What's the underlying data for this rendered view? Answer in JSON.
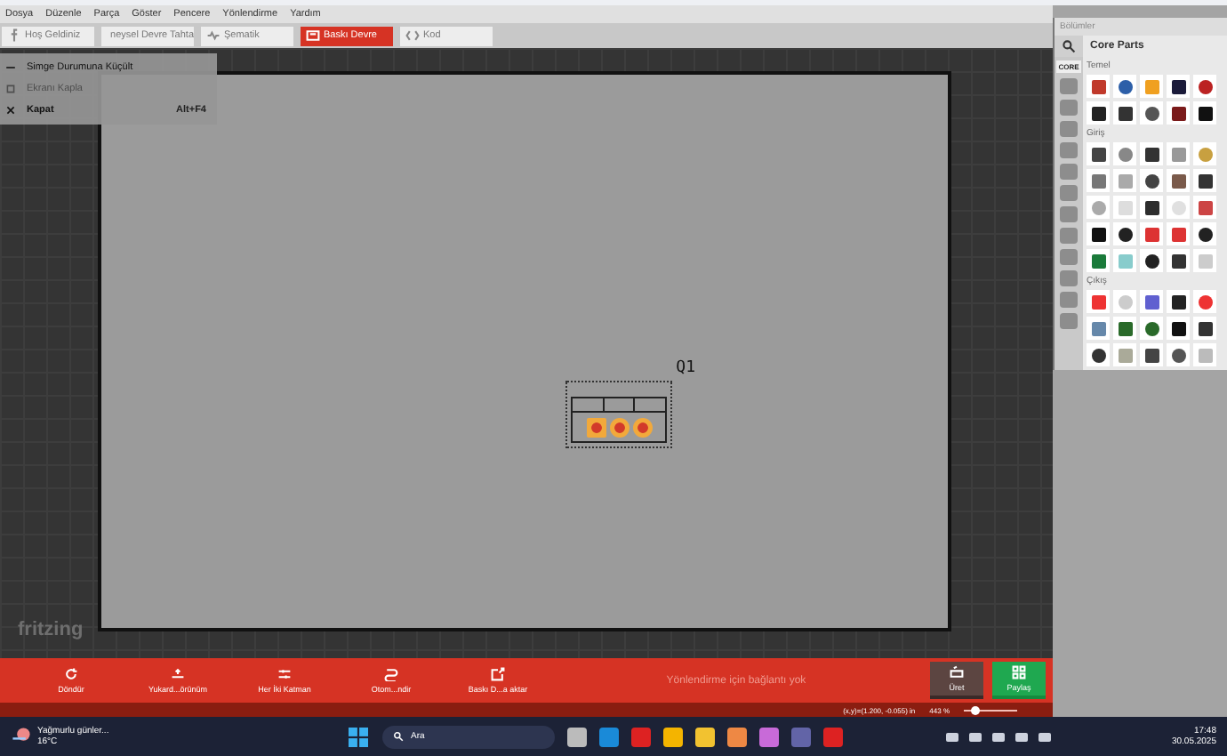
{
  "menu_bar": {
    "items": [
      {
        "label": "Dosya"
      },
      {
        "label": "Düzenle"
      },
      {
        "label": "Parça"
      },
      {
        "label": "Göster"
      },
      {
        "label": "Pencere"
      },
      {
        "label": "Yönlendirme"
      },
      {
        "label": "Yardım"
      }
    ]
  },
  "tabs": [
    {
      "label": "Hoş Geldiniz",
      "kind": "welcome",
      "selected": false
    },
    {
      "label": "neysel Devre Tahta",
      "kind": "breadboard",
      "selected": false
    },
    {
      "label": "Şematik",
      "kind": "schematic",
      "selected": false
    },
    {
      "label": "Baskı Devre",
      "kind": "pcb",
      "selected": true
    },
    {
      "label": "Kod",
      "kind": "code",
      "selected": false
    }
  ],
  "window_menu": {
    "items": [
      {
        "label": "Simge Durumuna Küçült",
        "kind": "minimize",
        "disabled": false
      },
      {
        "label": "Ekranı Kapla",
        "kind": "maximize",
        "disabled": true
      },
      {
        "label": "Kapat",
        "kind": "close",
        "shortcut": "Alt+F4",
        "disabled": false
      }
    ]
  },
  "canvas": {
    "watermark": "fritzing",
    "part": {
      "label": "Q1"
    }
  },
  "toolbar": {
    "buttons": [
      {
        "label": "Döndür",
        "kind": "rotate"
      },
      {
        "label": "Yukard...örünüm",
        "kind": "view"
      },
      {
        "label": "Her İki Katman",
        "kind": "layers"
      },
      {
        "label": "Otom...ndir",
        "kind": "route"
      },
      {
        "label": "Baskı D...a aktar",
        "kind": "export"
      }
    ],
    "message": "Yönlendirme için bağlantı yok",
    "actions": [
      {
        "label": "Üret",
        "kind": "fab"
      },
      {
        "label": "Paylaş",
        "kind": "share"
      }
    ]
  },
  "status_bar": {
    "coordinates": "(x,y)=(1.200, -0.055) in",
    "zoom": "443 %",
    "zoom_slider": {
      "level": 0.2
    }
  },
  "parts_bin": {
    "title": "Bölümler",
    "heading": "Core Parts",
    "tabs": [
      {
        "label": "CORE",
        "selected": true
      }
    ],
    "sections": [
      {
        "label": "Temel"
      },
      {
        "label": "Giriş"
      },
      {
        "label": "Çıkış"
      }
    ]
  },
  "taskbar": {
    "weather": "Yağmurlu günler...",
    "temperature": "16°C",
    "search_placeholder": "Ara",
    "time": "17:48",
    "date": "30.05.2025"
  }
}
